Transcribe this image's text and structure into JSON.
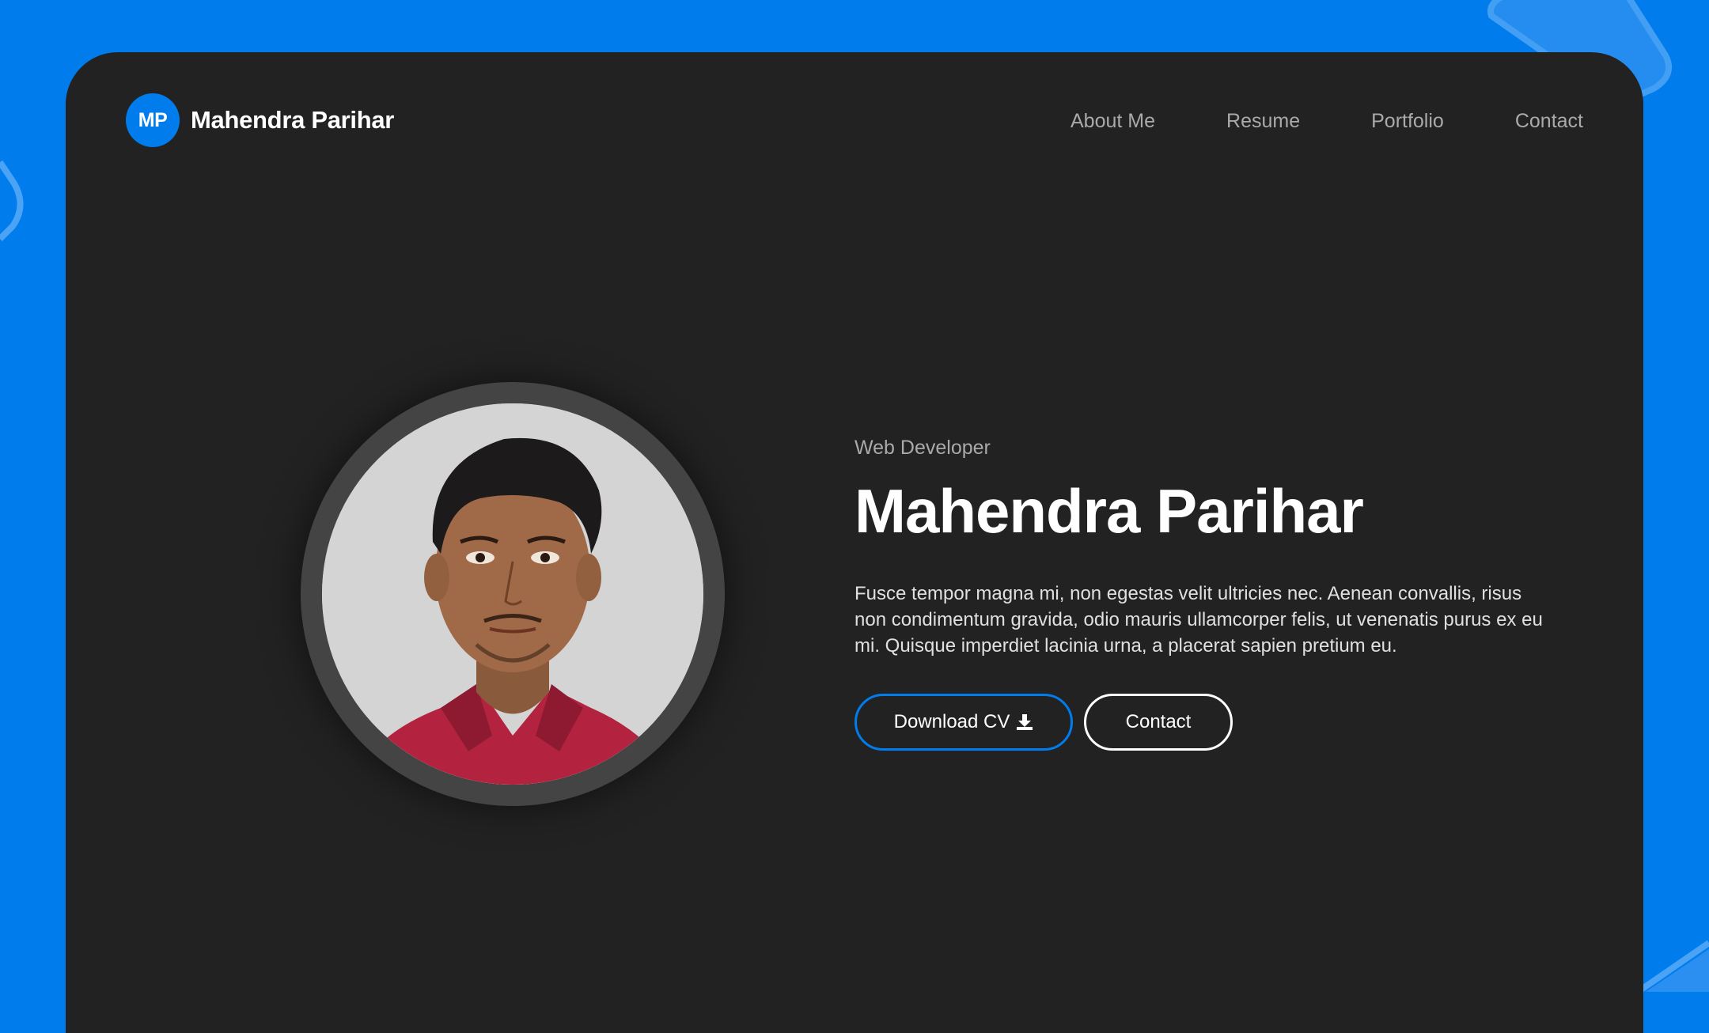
{
  "header": {
    "logo_initials": "MP",
    "logo_name": "Mahendra Parihar",
    "nav": [
      {
        "label": "About Me"
      },
      {
        "label": "Resume"
      },
      {
        "label": "Portfolio"
      },
      {
        "label": "Contact"
      }
    ]
  },
  "hero": {
    "subtitle": "Web Developer",
    "title": "Mahendra Parihar",
    "bio": "Fusce tempor magna mi, non egestas velit ultricies nec. Aenean convallis, risus non condimentum gravida, odio mauris ullamcorper felis, ut venenatis purus ex eu mi. Quisque imperdiet lacinia urna, a placerat sapien pretium eu.",
    "download_label": "Download CV",
    "download_icon": "download-icon",
    "contact_label": "Contact"
  },
  "colors": {
    "accent": "#007ced",
    "card_bg": "#222222",
    "ring": "#444444"
  }
}
